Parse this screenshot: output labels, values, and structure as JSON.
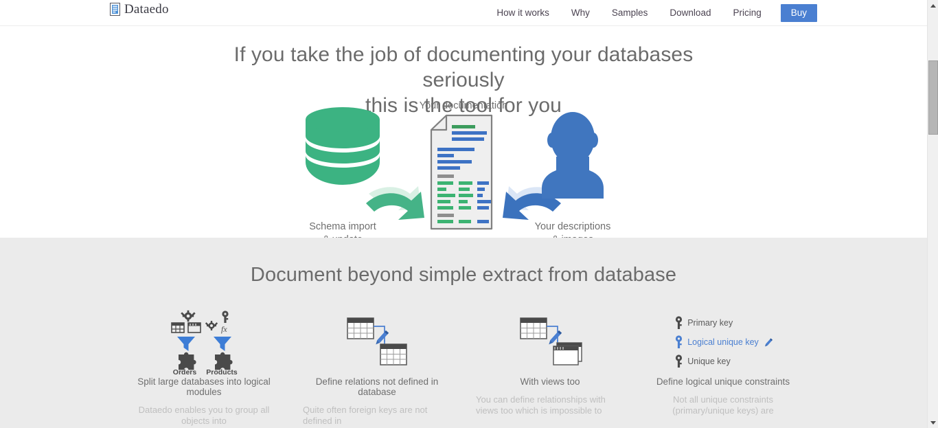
{
  "nav": {
    "brand": "Dataedo",
    "brand_icon": "document-logo-icon",
    "links": [
      {
        "label": "How it works",
        "name": "nav-how-it-works"
      },
      {
        "label": "Why",
        "name": "nav-why"
      },
      {
        "label": "Samples",
        "name": "nav-samples"
      },
      {
        "label": "Download",
        "name": "nav-download"
      },
      {
        "label": "Pricing",
        "name": "nav-pricing"
      }
    ],
    "buy_label": "Buy",
    "buy_color": "#4a7fd1"
  },
  "hero": {
    "title_line1": "If you take the job of documenting your databases seriously",
    "title_line2": "this is the tool for you",
    "graphic": {
      "db_label_line1": "Schema import",
      "db_label_line2": "& update",
      "doc_label": "Your documentation",
      "person_label_line1": "Your descriptions",
      "person_label_line2": "& images",
      "db_color": "#3cb382",
      "person_color": "#4076bf",
      "arrow_green": "#4bb387",
      "arrow_blue": "#3b72bd"
    }
  },
  "features": {
    "title": "Document beyond simple extract from database",
    "columns": [
      {
        "icon": "modules-puzzle-icon",
        "module1": "Orders",
        "module2": "Products",
        "heading": "Split large databases into logical modules",
        "body": "Dataedo enables you to group all objects into",
        "body_align": "center"
      },
      {
        "icon": "table-relation-pencil-icon",
        "heading": "Define relations not defined in database",
        "body": "Quite often foreign keys are not defined in",
        "body_align": "left"
      },
      {
        "icon": "table-view-relation-icon",
        "heading": "With views too",
        "body": "You can define relationships with views too which is impossible to",
        "body_align": "left"
      },
      {
        "icon": "keys-list-icon",
        "keys": [
          {
            "label": "Primary key",
            "color": "#5b5b5b",
            "editable": false
          },
          {
            "label": "Logical unique key",
            "color": "#4a7fd1",
            "editable": true
          },
          {
            "label": "Unique key",
            "color": "#5b5b5b",
            "editable": false
          }
        ],
        "heading": "Define logical unique constraints",
        "body": "Not all unique constraints (primary/unique keys) are",
        "body_align": "center"
      }
    ]
  },
  "scrollbar": {
    "up_icon": "scroll-up-arrow-icon",
    "down_icon": "scroll-down-arrow-icon",
    "thumb": "scrollbar-thumb"
  }
}
